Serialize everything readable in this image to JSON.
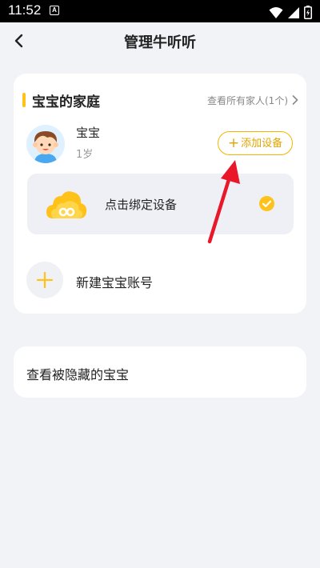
{
  "status_bar": {
    "time": "11:52",
    "a_badge": "A"
  },
  "header": {
    "title": "管理牛听听"
  },
  "family": {
    "section_title": "宝宝的家庭",
    "view_all": "查看所有家人(1个)",
    "baby": {
      "name": "宝宝",
      "age": "1岁"
    },
    "add_device": "添加设备",
    "bind_device": "点击绑定设备",
    "new_baby": "新建宝宝账号"
  },
  "hidden_babies": "查看被隐藏的宝宝",
  "colors": {
    "accent": "#ffc21a",
    "accent_border": "#f5b400",
    "arrow": "#e8172a",
    "background": "#f2f3f7"
  },
  "icons": [
    "back-arrow-icon",
    "chevron-right-icon",
    "baby-avatar-icon",
    "plus-icon",
    "cloud-device-icon",
    "check-icon",
    "wifi-icon",
    "signal-icon",
    "battery-icon"
  ]
}
